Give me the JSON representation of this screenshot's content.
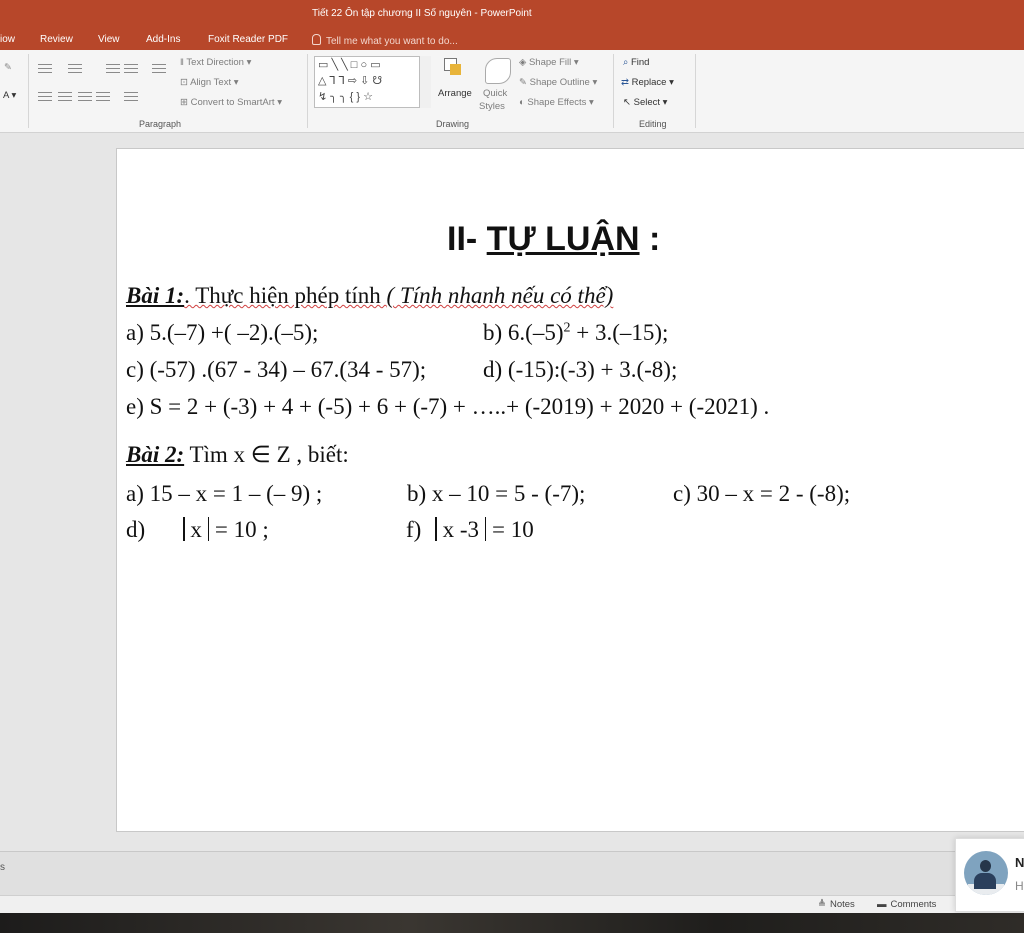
{
  "app": {
    "window_title": "Tiết 22 Ôn tập chương II Số nguyên - PowerPoint"
  },
  "tabs": [
    {
      "label": "iow"
    },
    {
      "label": "Review"
    },
    {
      "label": "View"
    },
    {
      "label": "Add-Ins"
    },
    {
      "label": "Foxit Reader PDF"
    }
  ],
  "tell_me": "Tell me what you want to do...",
  "ribbon": {
    "paragraph": {
      "label": "Paragraph",
      "text_direction": "Text Direction",
      "align_text": "Align Text",
      "convert_smartart": "Convert to SmartArt"
    },
    "drawing": {
      "label": "Drawing",
      "shapes_row1": "▭ ╲ ╲ □ ○ ▭",
      "shapes_row2": "△ ⅂ ⅂ ⇨ ⇩ ☋",
      "shapes_row3": "↯ ╮ ╮ { } ☆",
      "arrange": "Arrange",
      "quick_styles_1": "Quick",
      "quick_styles_2": "Styles",
      "shape_fill": "Shape Fill",
      "shape_outline": "Shape Outline",
      "shape_effects": "Shape Effects"
    },
    "editing": {
      "label": "Editing",
      "find": "Find",
      "replace": "Replace",
      "select": "Select"
    }
  },
  "slide": {
    "heading_prefix": "II- ",
    "heading_main": "TỰ LUẬN",
    "heading_suffix": " :",
    "bai1": {
      "label": "Bài  1:",
      "text": ". Thực hiện phép tính ",
      "hint": "( Tính nhanh nếu có thể)"
    },
    "bai1_items": {
      "a": "a)    5.(–7) +( –2).(–5);",
      "b_main": "b) 6.(–5)",
      "b_sup": "2",
      "b_rest": " + 3.(–15);",
      "c": "c) (-57) .(67 - 34) – 67.(34 - 57);",
      "d": "d) (-15):(-3) + 3.(-8);",
      "e": "e) S = 2 + (-3) + 4 + (-5) + 6 + (-7) + …..+  (-2019) + 2020 + (-2021) ."
    },
    "bai2": {
      "label": "Bài 2:",
      "text": "  Tìm x ∈ Z , biết:"
    },
    "bai2_items": {
      "a": "a)    15 – x = 1 – (– 9) ;",
      "b": "b)  x – 10 = 5 - (-7);",
      "c": "c) 30 – x = 2 - (-8);",
      "d_label": "d)",
      "d_inner": "x ",
      "d_rest": "= 10      ;",
      "f_label": "f)",
      "f_inner": "x -3",
      "f_rest": "= 10"
    }
  },
  "status": {
    "notes": "Notes",
    "comments": "Comments",
    "notes_pane_mark": "s"
  },
  "popup": {
    "initial": "N",
    "sub": "H"
  }
}
